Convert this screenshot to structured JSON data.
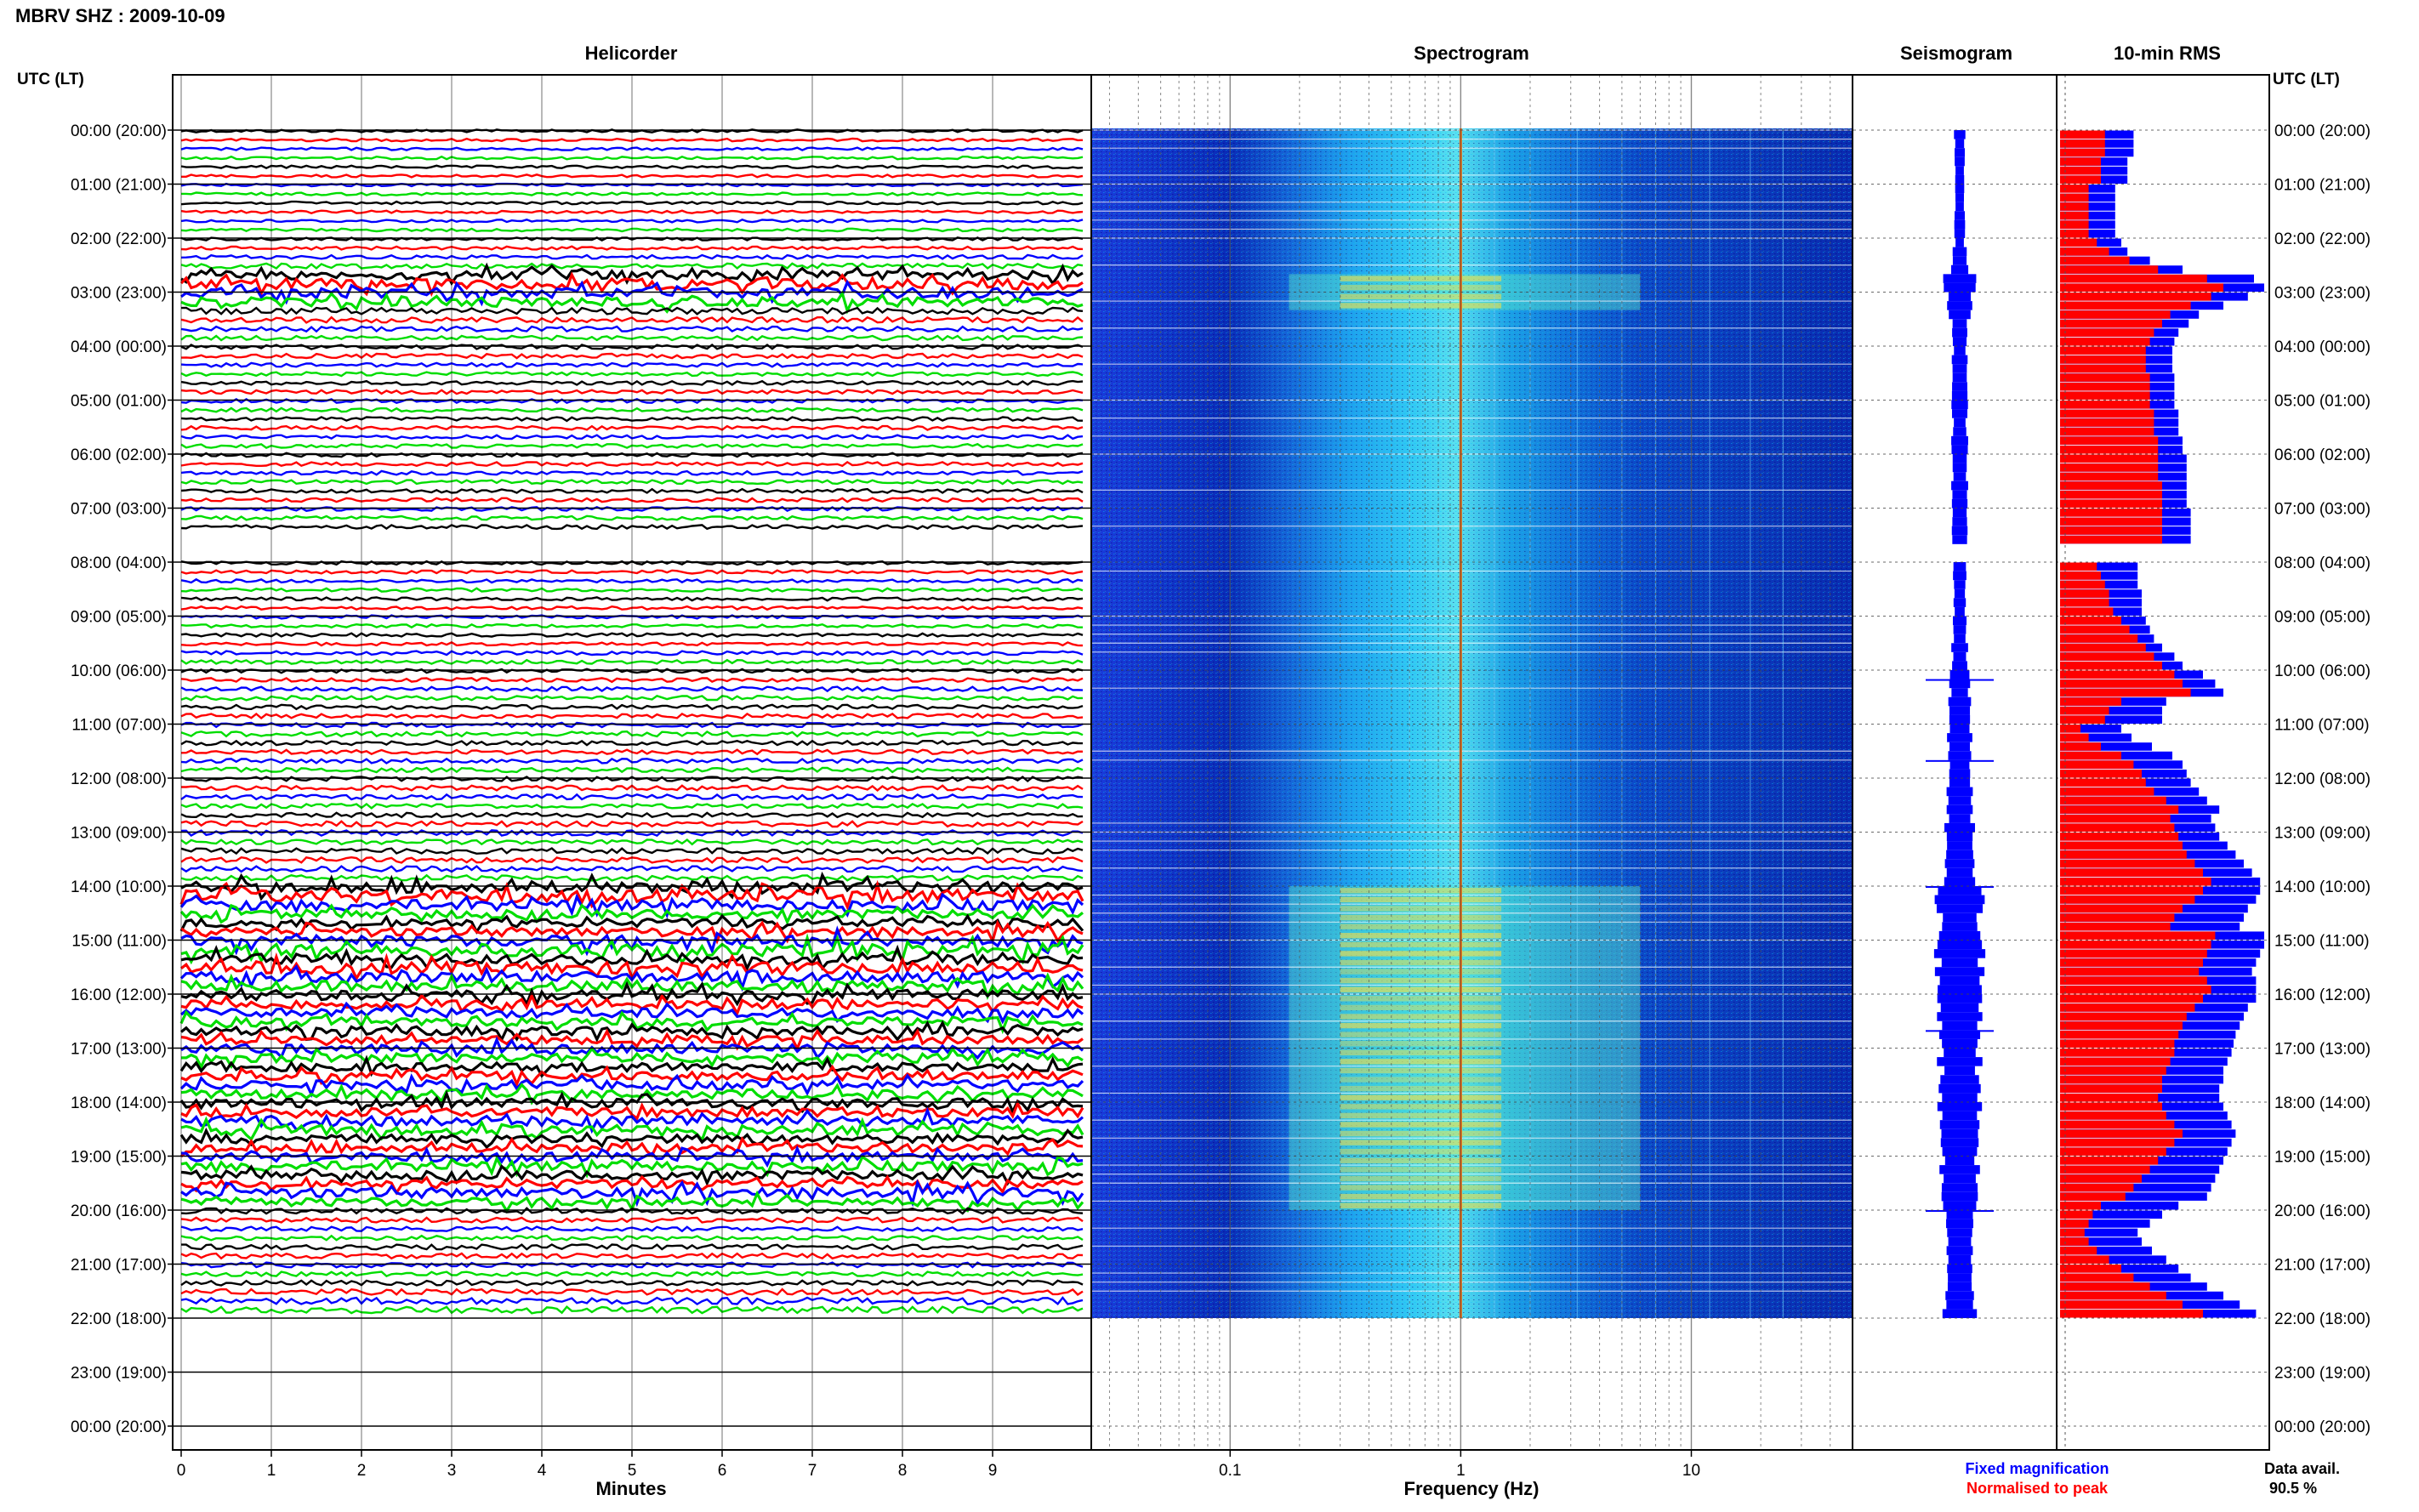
{
  "header": {
    "title": "MBRV SHZ : 2009-10-09"
  },
  "panels": {
    "helicorder_title": "Helicorder",
    "spectrogram_title": "Spectrogram",
    "seismogram_title": "Seismogram",
    "rms_title": "10-min RMS",
    "left_axis_header": "UTC (LT)",
    "right_axis_header": "UTC (LT)"
  },
  "legend": {
    "fixed_label": "Fixed magnification",
    "normalised_label": "Normalised to peak",
    "fixed_color": "#0000ff",
    "normalised_color": "#ff0000"
  },
  "data_availability": {
    "label": "Data avail.",
    "value": "90.5 %"
  },
  "colors": {
    "trace_cycle": [
      "#000000",
      "#ff0000",
      "#0000ff",
      "#00dd00"
    ],
    "spectrogram_low": "#0000a0",
    "spectrogram_high": "#ffff00",
    "seismogram": "#0000ff"
  },
  "chart_data": [
    {
      "type": "line",
      "name": "helicorder",
      "title": "Helicorder",
      "xlabel": "Minutes",
      "ylabel": "UTC (LT)",
      "xlim": [
        0,
        10
      ],
      "x_ticks": [
        0,
        1,
        2,
        3,
        4,
        5,
        6,
        7,
        8,
        9
      ],
      "y_tick_labels": [
        "00:00 (20:00)",
        "01:00 (21:00)",
        "02:00 (22:00)",
        "03:00 (23:00)",
        "04:00 (00:00)",
        "05:00 (01:00)",
        "06:00 (02:00)",
        "07:00 (03:00)",
        "08:00 (04:00)",
        "09:00 (05:00)",
        "10:00 (06:00)",
        "11:00 (07:00)",
        "12:00 (08:00)",
        "13:00 (09:00)",
        "14:00 (10:00)",
        "15:00 (11:00)",
        "16:00 (12:00)",
        "17:00 (13:00)",
        "18:00 (14:00)",
        "19:00 (15:00)",
        "20:00 (16:00)",
        "21:00 (17:00)",
        "22:00 (18:00)",
        "23:00 (19:00)",
        "00:00 (20:00)"
      ],
      "rows_per_hour": 6,
      "data_end_hour": 22,
      "gap_hours": [
        7.4,
        7.6
      ],
      "row_amplitude": [
        0.5,
        0.5,
        0.5,
        0.5,
        0.5,
        0.5,
        0.5,
        0.5,
        0.5,
        0.5,
        0.5,
        0.5,
        0.5,
        0.6,
        0.7,
        0.9,
        1.6,
        1.9,
        1.8,
        1.6,
        1.2,
        1.0,
        0.9,
        0.8,
        0.8,
        0.8,
        0.7,
        0.7,
        0.7,
        0.7,
        0.7,
        0.7,
        0.7,
        0.7,
        0.7,
        0.7,
        0.7,
        0.7,
        0.7,
        0.7,
        0.7,
        0.7,
        0.7,
        0.7,
        0.7,
        0.7,
        0.0,
        0.0,
        0.6,
        0.6,
        0.6,
        0.6,
        0.6,
        0.6,
        0.6,
        0.6,
        0.6,
        0.6,
        0.7,
        0.7,
        0.7,
        0.7,
        0.8,
        0.8,
        0.8,
        0.8,
        0.8,
        0.9,
        0.8,
        0.8,
        0.8,
        0.8,
        0.8,
        0.9,
        0.9,
        0.8,
        0.8,
        1.0,
        1.0,
        0.9,
        1.0,
        1.0,
        1.0,
        1.0,
        2.0,
        2.2,
        1.8,
        1.5,
        1.5,
        1.6,
        2.0,
        2.2,
        1.8,
        2.0,
        1.8,
        1.8,
        1.8,
        1.8,
        1.6,
        1.6,
        1.5,
        1.5,
        1.6,
        1.6,
        1.5,
        1.5,
        1.6,
        1.6,
        1.6,
        1.6,
        1.8,
        1.8,
        1.5,
        1.5,
        1.6,
        1.6,
        1.5,
        1.5,
        1.8,
        1.5,
        1.0,
        0.9,
        0.8,
        0.8,
        0.9,
        0.9,
        0.9,
        0.8,
        0.9,
        1.0,
        1.2,
        1.2
      ]
    },
    {
      "type": "heatmap",
      "name": "spectrogram",
      "title": "Spectrogram",
      "xlabel": "Frequency (Hz)",
      "x_scale": "log",
      "xlim": [
        0.025,
        50
      ],
      "x_tick_labels": [
        "0.1",
        "1",
        "10"
      ],
      "x_tick_values": [
        0.1,
        1,
        10
      ],
      "spectral_line_hz": 1.0,
      "peak_band_hz": [
        0.3,
        1.5
      ]
    },
    {
      "type": "line",
      "name": "seismogram",
      "title": "Seismogram",
      "envelope": [
        0.4,
        0.4,
        0.4,
        0.4,
        0.4,
        0.4,
        0.4,
        0.4,
        0.4,
        0.4,
        0.4,
        0.4,
        0.4,
        0.5,
        0.6,
        0.8,
        1.2,
        1.3,
        1.0,
        0.9,
        0.8,
        0.7,
        0.7,
        0.6,
        0.6,
        0.6,
        0.6,
        0.6,
        0.6,
        0.6,
        0.6,
        0.6,
        0.6,
        0.6,
        0.6,
        0.6,
        0.6,
        0.6,
        0.6,
        0.6,
        0.6,
        0.6,
        0.6,
        0.6,
        0.6,
        0.6,
        0.0,
        0.0,
        0.5,
        0.5,
        0.5,
        0.5,
        0.5,
        0.5,
        0.6,
        0.6,
        0.6,
        0.6,
        0.6,
        0.7,
        0.7,
        0.8,
        0.8,
        0.8,
        0.9,
        1.0,
        1.0,
        1.0,
        0.9,
        0.9,
        0.9,
        1.0,
        1.0,
        1.1,
        1.1,
        1.0,
        1.0,
        1.2,
        1.2,
        1.1,
        1.2,
        1.3,
        1.3,
        1.4,
        1.9,
        2.1,
        1.7,
        1.5,
        1.5,
        1.6,
        2.0,
        2.1,
        1.8,
        1.9,
        1.8,
        1.7,
        1.8,
        1.7,
        1.6,
        1.6,
        1.5,
        1.5,
        1.6,
        1.6,
        1.5,
        1.5,
        1.6,
        1.6,
        1.6,
        1.7,
        1.8,
        1.8,
        1.6,
        1.5,
        1.5,
        1.5,
        1.4,
        1.4,
        1.6,
        1.4,
        1.1,
        1.0,
        0.9,
        0.9,
        1.0,
        1.0,
        1.0,
        1.0,
        1.1,
        1.2,
        1.3,
        1.4
      ]
    },
    {
      "type": "bar",
      "name": "10-min RMS",
      "title": "10-min RMS",
      "orientation": "horizontal",
      "xlim": [
        0,
        1
      ],
      "series": [
        {
          "name": "Fixed magnification",
          "color": "#0000ff",
          "values": [
            0.36,
            0.36,
            0.36,
            0.33,
            0.33,
            0.33,
            0.27,
            0.27,
            0.27,
            0.27,
            0.27,
            0.27,
            0.3,
            0.33,
            0.44,
            0.6,
            0.95,
            1.0,
            0.92,
            0.8,
            0.68,
            0.63,
            0.58,
            0.56,
            0.55,
            0.55,
            0.55,
            0.56,
            0.56,
            0.56,
            0.56,
            0.58,
            0.58,
            0.58,
            0.6,
            0.6,
            0.62,
            0.62,
            0.62,
            0.62,
            0.62,
            0.62,
            0.64,
            0.64,
            0.64,
            0.64,
            0.0,
            0.0,
            0.38,
            0.38,
            0.38,
            0.4,
            0.4,
            0.4,
            0.42,
            0.44,
            0.46,
            0.5,
            0.56,
            0.6,
            0.7,
            0.76,
            0.8,
            0.52,
            0.5,
            0.5,
            0.3,
            0.35,
            0.45,
            0.55,
            0.6,
            0.62,
            0.64,
            0.68,
            0.72,
            0.78,
            0.74,
            0.76,
            0.78,
            0.82,
            0.86,
            0.9,
            0.94,
            0.98,
            0.98,
            0.96,
            0.92,
            0.9,
            0.88,
            1.0,
            1.0,
            0.98,
            0.96,
            0.94,
            0.96,
            0.96,
            0.96,
            0.92,
            0.9,
            0.88,
            0.86,
            0.85,
            0.84,
            0.82,
            0.8,
            0.8,
            0.78,
            0.78,
            0.8,
            0.82,
            0.84,
            0.86,
            0.84,
            0.82,
            0.8,
            0.78,
            0.76,
            0.74,
            0.72,
            0.58,
            0.5,
            0.44,
            0.38,
            0.4,
            0.45,
            0.52,
            0.58,
            0.64,
            0.72,
            0.8,
            0.88,
            0.96
          ]
        },
        {
          "name": "Normalised to peak",
          "color": "#ff0000",
          "values": [
            0.22,
            0.22,
            0.22,
            0.2,
            0.2,
            0.2,
            0.14,
            0.14,
            0.14,
            0.14,
            0.14,
            0.14,
            0.18,
            0.24,
            0.34,
            0.48,
            0.72,
            0.8,
            0.74,
            0.64,
            0.54,
            0.5,
            0.46,
            0.44,
            0.42,
            0.42,
            0.42,
            0.44,
            0.44,
            0.44,
            0.44,
            0.46,
            0.46,
            0.46,
            0.48,
            0.48,
            0.48,
            0.48,
            0.48,
            0.5,
            0.5,
            0.5,
            0.5,
            0.5,
            0.5,
            0.5,
            0.0,
            0.0,
            0.18,
            0.2,
            0.22,
            0.24,
            0.24,
            0.26,
            0.3,
            0.34,
            0.38,
            0.42,
            0.46,
            0.5,
            0.56,
            0.6,
            0.64,
            0.3,
            0.24,
            0.22,
            0.1,
            0.14,
            0.2,
            0.3,
            0.36,
            0.4,
            0.42,
            0.46,
            0.52,
            0.58,
            0.54,
            0.56,
            0.58,
            0.6,
            0.62,
            0.66,
            0.7,
            0.74,
            0.7,
            0.66,
            0.6,
            0.56,
            0.54,
            0.76,
            0.74,
            0.72,
            0.7,
            0.68,
            0.72,
            0.74,
            0.7,
            0.66,
            0.62,
            0.6,
            0.58,
            0.56,
            0.56,
            0.54,
            0.52,
            0.5,
            0.5,
            0.48,
            0.5,
            0.52,
            0.56,
            0.6,
            0.56,
            0.52,
            0.48,
            0.44,
            0.4,
            0.36,
            0.32,
            0.2,
            0.16,
            0.14,
            0.12,
            0.14,
            0.18,
            0.24,
            0.3,
            0.36,
            0.44,
            0.52,
            0.6,
            0.7
          ]
        }
      ]
    }
  ]
}
